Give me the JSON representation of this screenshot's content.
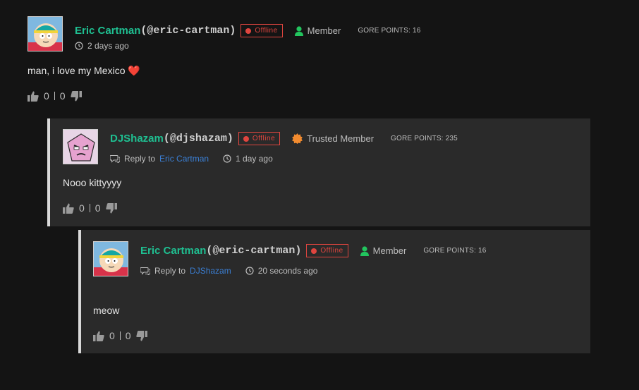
{
  "colors": {
    "background": "#141414",
    "card": "#2a2a2a",
    "username": "#1fbf91",
    "offline": "#e0453f",
    "member_icon": "#22c55e",
    "trusted_icon": "#f28b2f",
    "link": "#3b7fd4"
  },
  "comments": [
    {
      "username": "Eric Cartman",
      "handle": "(@eric-cartman)",
      "status": "Offline",
      "role": "Member",
      "role_icon": "user-icon",
      "gore_points": "GORE POINTS: 16",
      "time": "2 days ago",
      "body": "man, i love my Mexico ❤️",
      "upvotes": "0",
      "downvotes": "0"
    },
    {
      "username": "DJShazam",
      "handle": "(@djshazam)",
      "status": "Offline",
      "role": "Trusted Member",
      "role_icon": "badge-icon",
      "gore_points": "GORE POINTS: 235",
      "reply_label": "Reply to",
      "reply_to": "Eric Cartman",
      "time": "1 day ago",
      "body": "Nooo kittyyyy",
      "upvotes": "0",
      "downvotes": "0"
    },
    {
      "username": "Eric Cartman",
      "handle": "(@eric-cartman)",
      "status": "Offline",
      "role": "Member",
      "role_icon": "user-icon",
      "gore_points": "GORE POINTS: 16",
      "reply_label": "Reply to",
      "reply_to": "DJShazam",
      "time": "20 seconds ago",
      "body": "meow",
      "upvotes": "0",
      "downvotes": "0"
    }
  ]
}
